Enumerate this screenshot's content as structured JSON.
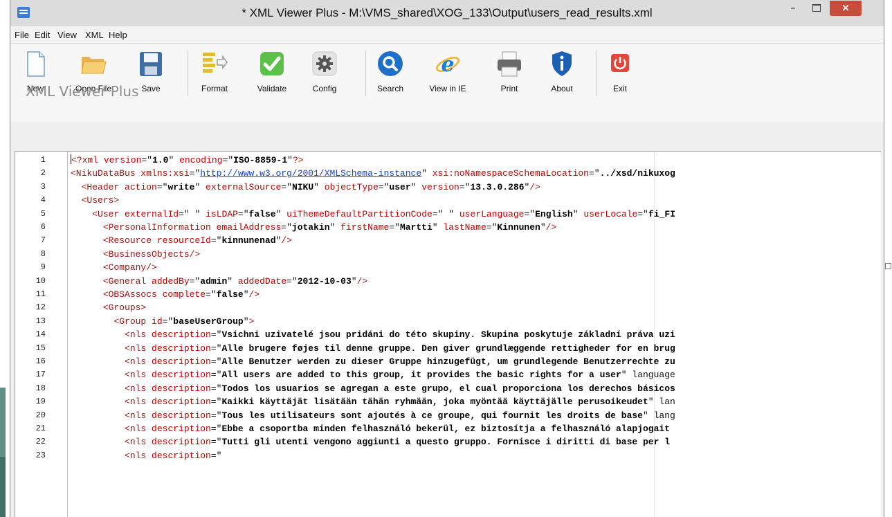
{
  "window": {
    "title": "* XML Viewer Plus - M:\\VMS_shared\\XOG_133\\Output\\users_read_results.xml",
    "close_glyph": "×",
    "min_glyph": "–"
  },
  "menu": [
    "File",
    "Edit",
    "View",
    "XML",
    "Help"
  ],
  "toolbar": [
    {
      "label": "New",
      "icon": "new-file-icon"
    },
    {
      "label": "Open File",
      "icon": "folder-icon"
    },
    {
      "label": "Save",
      "icon": "floppy-disk-icon"
    },
    {
      "label": "Format",
      "icon": "format-icon"
    },
    {
      "label": "Validate",
      "icon": "checkmark-icon"
    },
    {
      "label": "Config",
      "icon": "gear-icon"
    },
    {
      "label": "Search",
      "icon": "magnifier-icon"
    },
    {
      "label": "View in IE",
      "icon": "internet-explorer-icon"
    },
    {
      "label": "Print",
      "icon": "printer-icon"
    },
    {
      "label": "About",
      "icon": "shield-info-icon"
    },
    {
      "label": "Exit",
      "icon": "power-icon"
    }
  ],
  "brand": "XML Viewer Plus",
  "colors": {
    "tag": "#a31515",
    "attr": "#c00000",
    "link": "#1a3fd0",
    "close": "#c74c3c"
  },
  "editor": {
    "lines": [
      {
        "n": "1",
        "text": "<?xml version=\"1.0\" encoding=\"ISO-8859-1\"?>"
      },
      {
        "n": "2",
        "text": "<NikuDataBus xmlns:xsi=\"http://www.w3.org/2001/XMLSchema-instance\" xsi:noNamespaceSchemaLocation=\"../xsd/nikuxog"
      },
      {
        "n": "3",
        "text": "  <Header action=\"write\" externalSource=\"NIKU\" objectType=\"user\" version=\"13.3.0.286\"/>"
      },
      {
        "n": "4",
        "text": "  <Users>"
      },
      {
        "n": "5",
        "text": "    <User externalId=\" \" isLDAP=\"false\" uiThemeDefaultPartitionCode=\" \" userLanguage=\"English\" userLocale=\"fi_FI"
      },
      {
        "n": "6",
        "text": "      <PersonalInformation emailAddress=\"jotakin\" firstName=\"Martti\" lastName=\"Kinnunen\"/>"
      },
      {
        "n": "7",
        "text": "      <Resource resourceId=\"kinnunenad\"/>"
      },
      {
        "n": "8",
        "text": "      <BusinessObjects/>"
      },
      {
        "n": "9",
        "text": "      <Company/>"
      },
      {
        "n": "10",
        "text": "      <General addedBy=\"admin\" addedDate=\"2012-10-03\"/>"
      },
      {
        "n": "11",
        "text": "      <OBSAssocs complete=\"false\"/>"
      },
      {
        "n": "12",
        "text": "      <Groups>"
      },
      {
        "n": "13",
        "text": "        <Group id=\"baseUserGroup\">"
      },
      {
        "n": "14",
        "text": "          <nls description=\"Vsichni uzivatelé jsou pridáni do této skupiny. Skupina poskytuje základní práva uzi"
      },
      {
        "n": "15",
        "text": "          <nls description=\"Alle brugere føjes til denne gruppe. Den giver grundlæggende rettigheder for en brug"
      },
      {
        "n": "16",
        "text": "          <nls description=\"Alle Benutzer werden zu dieser Gruppe hinzugefügt, um grundlegende Benutzerrechte zu"
      },
      {
        "n": "17",
        "text": "          <nls description=\"All users are added to this group, it provides the basic rights for a user\" language"
      },
      {
        "n": "18",
        "text": "          <nls description=\"Todos los usuarios se agregan a este grupo, el cual proporciona los derechos básicos"
      },
      {
        "n": "19",
        "text": "          <nls description=\"Kaikki käyttäjät lisätään tähän ryhmään, joka myöntää käyttäjälle perusoikeudet\" lan"
      },
      {
        "n": "20",
        "text": "          <nls description=\"Tous les utilisateurs sont ajoutés à ce groupe, qui fournit les droits de base\" lang"
      },
      {
        "n": "21",
        "text": "          <nls description=\"Ebbe a csoportba minden felhasználó bekerül, ez biztosítja a felhasználó alapjogait"
      },
      {
        "n": "22",
        "text": "          <nls description=\"Tutti gli utenti vengono aggiunti a questo gruppo. Fornisce i diritti di base per l"
      },
      {
        "n": "23",
        "text": "          <nls description=\""
      }
    ]
  }
}
